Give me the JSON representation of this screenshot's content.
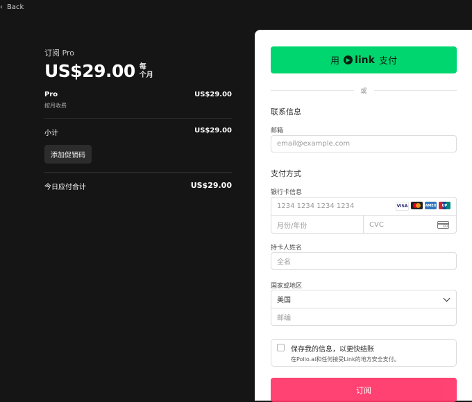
{
  "nav": {
    "back_label": "Back"
  },
  "summary": {
    "subscribe_label": "订阅 Pro",
    "price": "US$29.00",
    "per_line1": "每",
    "per_line2": "个月",
    "item_name": "Pro",
    "item_amount": "US$29.00",
    "item_sub": "按月收费",
    "subtotal_label": "小计",
    "subtotal_amount": "US$29.00",
    "promo_label": "添加促销码",
    "total_label": "今日应付合计",
    "total_amount": "US$29.00"
  },
  "payment": {
    "link_prefix": "用",
    "link_brand": "link",
    "link_suffix": "支付",
    "or_label": "或",
    "contact_title": "联系信息",
    "email_label": "邮箱",
    "email_placeholder": "email@example.com",
    "method_title": "支付方式",
    "card_label": "银行卡信息",
    "card_placeholder": "1234 1234 1234 1234",
    "brand_visa": "VISA",
    "brand_amex": "AMEX",
    "brand_union": "UP",
    "expiry_placeholder": "月份/年份",
    "cvc_placeholder": "CVC",
    "name_label": "持卡人姓名",
    "name_placeholder": "全名",
    "country_label": "国家或地区",
    "country_value": "美国",
    "zip_placeholder": "邮编",
    "save_title": "保存我的信息，以更快结账",
    "save_sub": "在Pollo.ai和任何接受Link的地方安全支付。",
    "pay_label": "订阅"
  },
  "colors": {
    "link_green": "#00d66f",
    "pay_pink": "#ff3366",
    "dark_bg": "#151515"
  }
}
